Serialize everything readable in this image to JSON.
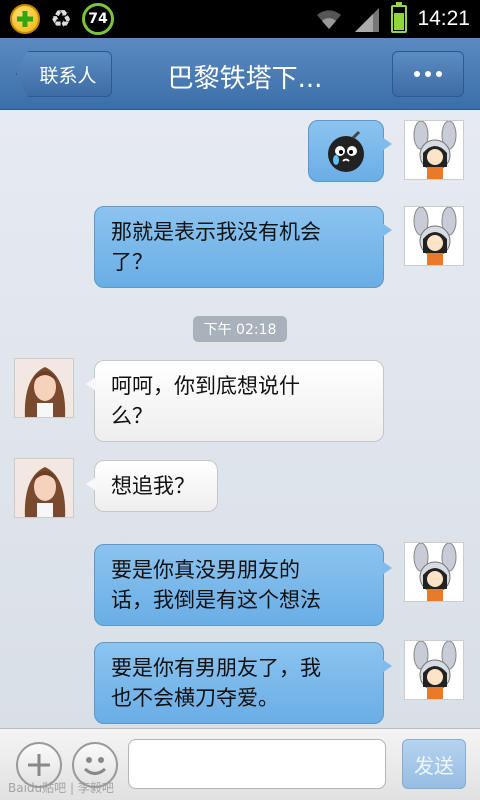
{
  "status_bar": {
    "badge_value": "74",
    "time": "14:21",
    "icons": [
      "add-app-icon",
      "recycle-icon",
      "battery-saver-badge",
      "wifi-icon",
      "signal-icon",
      "battery-icon"
    ],
    "battery_level": 0.7
  },
  "header": {
    "back_label": "联系人",
    "title": "巴黎铁塔下...",
    "more_icon": "more-dots-icon"
  },
  "colors": {
    "header": "#3c6fa9",
    "outgoing_bubble": "#7fbbec",
    "incoming_bubble": "#ffffff",
    "chat_background": "#dfe5ec"
  },
  "messages": [
    {
      "direction": "out",
      "type": "emoji",
      "content": "crying-bomb-emoji"
    },
    {
      "direction": "out",
      "type": "text",
      "lines": [
        "那就是表示我没有机会",
        "了？"
      ]
    },
    {
      "direction": "in",
      "type": "text",
      "lines": [
        "呵呵，你到底想说什",
        "么？"
      ]
    },
    {
      "direction": "in",
      "type": "text",
      "lines": [
        "想追我？"
      ]
    },
    {
      "direction": "out",
      "type": "text",
      "lines": [
        "要是你真没男朋友的",
        "话，我倒是有这个想法"
      ]
    },
    {
      "direction": "out",
      "type": "text",
      "lines": [
        "要是你有男朋友了，我",
        "也不会横刀夺爱。"
      ]
    }
  ],
  "timestamp": "下午 02:18",
  "input_bar": {
    "plus_icon": "plus-icon",
    "emoji_icon": "smiley-icon",
    "text_value": "",
    "send_label": "发送"
  },
  "watermark": "Baidu贴吧 | 李毅吧"
}
